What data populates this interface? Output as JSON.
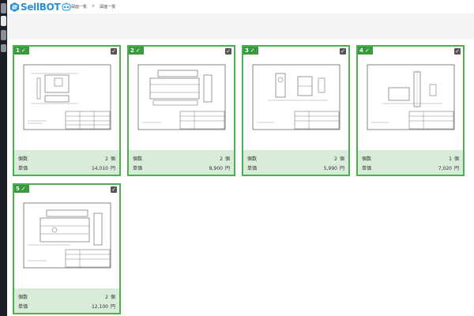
{
  "app": {
    "name": "SellBOT"
  },
  "breadcrumb": [
    {
      "label": "図面一覧"
    },
    {
      "label": ">"
    },
    {
      "label": "図面一覧"
    }
  ],
  "colors": {
    "accent": "#4caf50",
    "badge": "#3a9b3e",
    "footer": "#d8ecd9",
    "brand": "#2a8fd6"
  },
  "cards": [
    {
      "num": "1",
      "qty_label": "個数",
      "qty": "2",
      "qty_unit": "個",
      "price_label": "単価",
      "price": "14,010",
      "price_unit": "円"
    },
    {
      "num": "2",
      "qty_label": "個数",
      "qty": "2",
      "qty_unit": "個",
      "price_label": "単価",
      "price": "8,900",
      "price_unit": "円"
    },
    {
      "num": "3",
      "qty_label": "個数",
      "qty": "2",
      "qty_unit": "個",
      "price_label": "単価",
      "price": "5,990",
      "price_unit": "円"
    },
    {
      "num": "4",
      "qty_label": "個数",
      "qty": "1",
      "qty_unit": "個",
      "price_label": "単価",
      "price": "7,020",
      "price_unit": "円"
    },
    {
      "num": "5",
      "qty_label": "個数",
      "qty": "2",
      "qty_unit": "個",
      "price_label": "単価",
      "price": "12,100",
      "price_unit": "円"
    }
  ],
  "icons": {
    "check": "✓",
    "checkbox": "✓"
  }
}
